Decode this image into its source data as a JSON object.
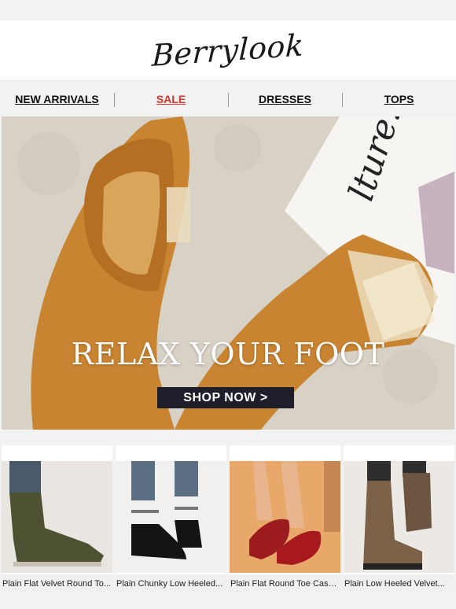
{
  "brand": {
    "name": "Berrylook"
  },
  "nav": {
    "items": [
      "NEW ARRIVALS",
      "SALE",
      "DRESSES",
      "TOPS"
    ]
  },
  "hero": {
    "headline": "RELAX YOUR FOOT",
    "cta": "SHOP NOW >"
  },
  "products": [
    {
      "name": "Plain Flat Velvet Round To...",
      "image_icon": "ankle-boot-icon"
    },
    {
      "name": "Plain Chunky Low Heeled...",
      "image_icon": "flat-shoe-icon"
    },
    {
      "name": "Plain Flat Round Toe Casu...",
      "image_icon": "loafer-icon"
    },
    {
      "name": "Plain Low Heeled Velvet...",
      "image_icon": "winter-boot-icon"
    }
  ],
  "colors": {
    "accent_sale": "#d0392b",
    "cta_bg": "#1f1f2b",
    "shoe_tan": "#c9822e"
  }
}
